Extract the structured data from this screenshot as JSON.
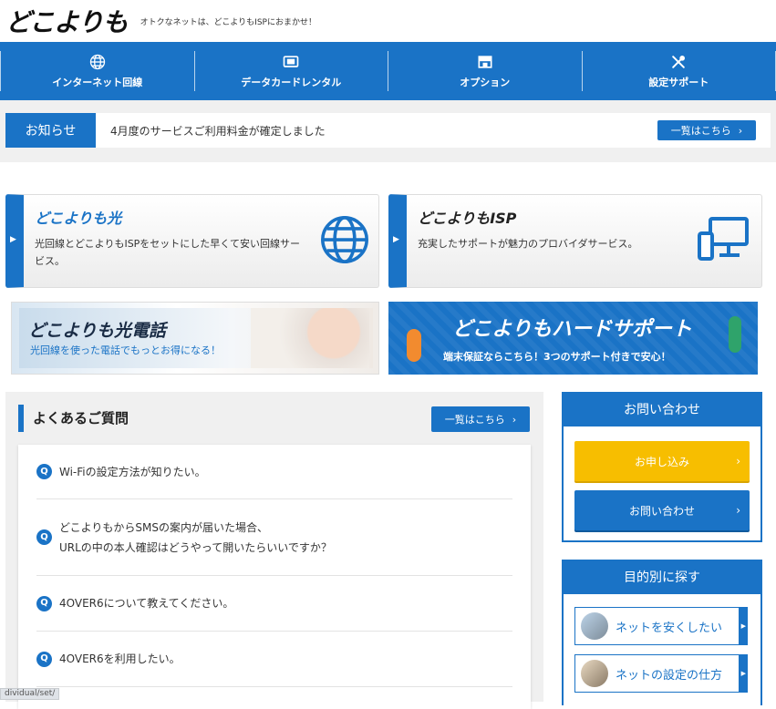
{
  "header": {
    "logo": "どこよりも",
    "tagline": "オトクなネットは、どこよりもISPにおまかせ！"
  },
  "nav": [
    {
      "label": "インターネット回線",
      "icon": "globe-icon"
    },
    {
      "label": "データカードレンタル",
      "icon": "data-card-icon"
    },
    {
      "label": "オプション",
      "icon": "shop-icon"
    },
    {
      "label": "設定サポート",
      "icon": "tools-icon"
    }
  ],
  "notice": {
    "label": "お知らせ",
    "text": "4月度のサービスご利用料金が確定しました",
    "more": "一覧はこちら"
  },
  "services": [
    {
      "name": "どこよりも光",
      "desc": "光回線とどこよりもISPをセットにした早くて安い回線サービス。",
      "icon": "globe-icon"
    },
    {
      "name": "どこよりもISP",
      "desc": "充実したサポートが魅力のプロバイダサービス。",
      "icon": "devices-icon"
    }
  ],
  "banners": {
    "phone": {
      "title": "どこよりも光電話",
      "sub": "光回線を使った電話でもっとお得になる！"
    },
    "hard": {
      "title": "どこよりもハードサポート",
      "sub": "端末保証ならこちら！3つのサポート付きで安心！"
    }
  },
  "faq": {
    "title": "よくあるご質問",
    "more": "一覧はこちら",
    "items": [
      {
        "lines": [
          "Wi-Fiの設定方法が知りたい。"
        ]
      },
      {
        "lines": [
          "どこよりもからSMSの案内が届いた場合、",
          "URLの中の本人確認はどうやって開いたらいいですか？"
        ]
      },
      {
        "lines": [
          "4OVER6について教えてください。"
        ]
      },
      {
        "lines": [
          "4OVER6を利用したい。"
        ]
      }
    ]
  },
  "contact": {
    "title": "お問い合わせ",
    "apply": "お申し込み",
    "inquiry": "お問い合わせ"
  },
  "purpose": {
    "title": "目的別に探す",
    "items": [
      "ネットを安くしたい",
      "ネットの設定の仕方"
    ]
  },
  "status_url": "dividual/set/",
  "colors": {
    "primary": "#1a73c6",
    "apply": "#f7be00"
  }
}
